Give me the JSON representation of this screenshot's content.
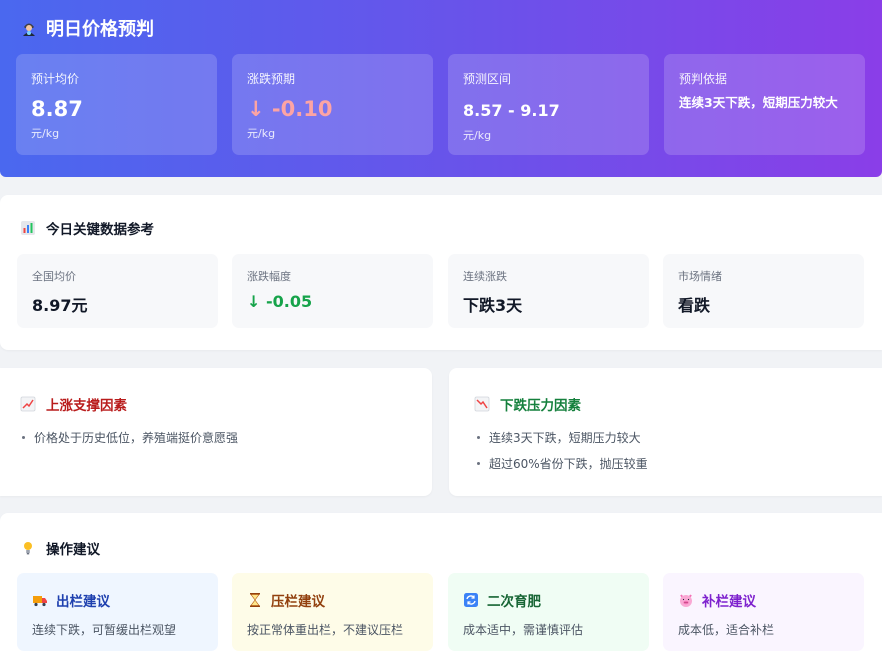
{
  "header": {
    "title": "明日价格预判",
    "icon": "fortune-teller-icon",
    "cards": {
      "avg": {
        "label": "预计均价",
        "value": "8.87",
        "unit": "元/kg"
      },
      "change": {
        "label": "涨跌预期",
        "value": "-0.10",
        "arrow": "↓",
        "unit": "元/kg",
        "color": "#fda4a4"
      },
      "range": {
        "label": "预测区间",
        "value": "8.57 - 9.17",
        "unit": "元/kg"
      },
      "basis": {
        "label": "预判依据",
        "value": "连续3天下跌，短期压力较大"
      }
    }
  },
  "today": {
    "title": "今日关键数据参考",
    "icon": "bar-chart-icon",
    "items": [
      {
        "label": "全国均价",
        "value": "8.97元"
      },
      {
        "label": "涨跌幅度",
        "value": "-0.05",
        "arrow": "↓",
        "color": "#16a34a"
      },
      {
        "label": "连续涨跌",
        "value": "下跌3天"
      },
      {
        "label": "市场情绪",
        "value": "看跌"
      }
    ]
  },
  "factors": {
    "up": {
      "title": "上涨支撑因素",
      "icon": "chart-increasing-icon",
      "color": "#b91c1c",
      "items": [
        "价格处于历史低位，养殖端挺价意愿强"
      ]
    },
    "down": {
      "title": "下跌压力因素",
      "icon": "chart-decreasing-icon",
      "color": "#15803d",
      "items": [
        "连续3天下跌，短期压力较大",
        "超过60%省份下跌，抛压较重"
      ]
    }
  },
  "advice": {
    "title": "操作建议",
    "icon": "light-bulb-icon",
    "items": [
      {
        "title": "出栏建议",
        "icon": "truck-icon",
        "desc": "连续下跌，可暂缓出栏观望",
        "color": "#1e40af",
        "bg": "#eff6ff"
      },
      {
        "title": "压栏建议",
        "icon": "hourglass-icon",
        "desc": "按正常体重出栏，不建议压栏",
        "color": "#92400e",
        "bg": "#fefce8"
      },
      {
        "title": "二次育肥",
        "icon": "repeat-icon",
        "desc": "成本适中，需谨慎评估",
        "color": "#166534",
        "bg": "#f0fdf4"
      },
      {
        "title": "补栏建议",
        "icon": "pig-icon",
        "desc": "成本低，适合补栏",
        "color": "#7e22ce",
        "bg": "#faf5ff"
      }
    ]
  }
}
